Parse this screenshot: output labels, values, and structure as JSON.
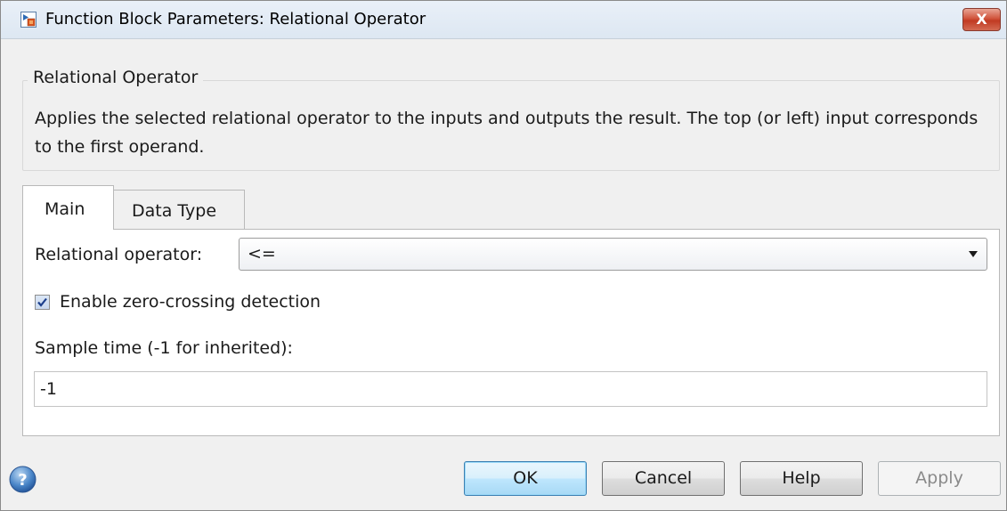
{
  "window": {
    "title": "Function Block Parameters: Relational Operator",
    "close_label": "X"
  },
  "description": {
    "group_title": "Relational Operator",
    "text": "Applies the selected relational operator to the inputs and outputs the result. The top (or left) input corresponds to the first operand."
  },
  "tabs": [
    {
      "label": "Main",
      "selected": true
    },
    {
      "label": "Data Type",
      "selected": false
    }
  ],
  "main": {
    "operator_label": "Relational operator:",
    "operator_value": "<=",
    "zero_crossing_label": "Enable zero-crossing detection",
    "zero_crossing_checked": true,
    "sample_time_label": "Sample time (-1 for inherited):",
    "sample_time_value": "-1"
  },
  "buttons": {
    "ok": "OK",
    "cancel": "Cancel",
    "help": "Help",
    "apply": "Apply"
  },
  "icons": {
    "app": "simulink-block-icon",
    "help": "question-circle-icon",
    "dropdown": "chevron-down-icon"
  },
  "colors": {
    "ok_button_accent": "#3c7fb1",
    "close_button": "#c13a22",
    "window_background": "#f0f0f0"
  }
}
